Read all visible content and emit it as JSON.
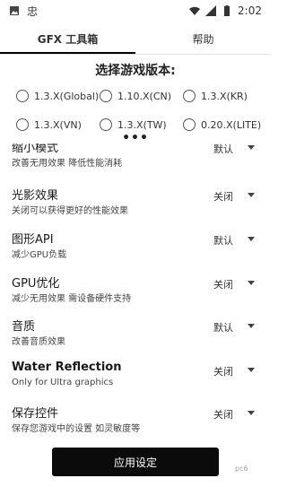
{
  "status_bar": {
    "time": "2:02",
    "left_icons": [
      "image-icon",
      "app-icon"
    ],
    "right_icons": [
      "wifi-icon",
      "signal-icon",
      "battery-icon"
    ]
  },
  "tabs": [
    {
      "label": "GFX 工具箱",
      "active": true
    },
    {
      "label": "帮助",
      "active": false
    }
  ],
  "version_select": {
    "title": "选择游戏版本:",
    "rows": [
      [
        "1.3.X(Global)",
        "1.10.X(CN)",
        "1.3.X(KR)"
      ],
      [
        "1.3.X(VN)",
        "1.3.X(TW)",
        "0.20.X(LITE)"
      ]
    ],
    "more": "•••"
  },
  "settings": [
    {
      "title": "缩小模式",
      "desc": "改善无用效果 降低性能消耗",
      "value": "默认"
    },
    {
      "title": "光影效果",
      "desc": "关闭可以获得更好的性能效果",
      "value": "关闭"
    },
    {
      "title": "图形API",
      "desc": "减少GPU负载",
      "value": "默认"
    },
    {
      "title": "GPU优化",
      "desc": "减少无用效果 需设备硬件支持",
      "value": "关闭"
    },
    {
      "title": "音质",
      "desc": "改善音质效果",
      "value": "默认"
    },
    {
      "title": "Water Reflection",
      "desc": "Only for Ultra graphics",
      "value": "关闭"
    },
    {
      "title": "保存控件",
      "desc": "保存您游戏中的设置 如灵敏度等",
      "value": "关闭"
    }
  ],
  "apply_button": {
    "label": "应用设定"
  },
  "watermark": "pc6"
}
